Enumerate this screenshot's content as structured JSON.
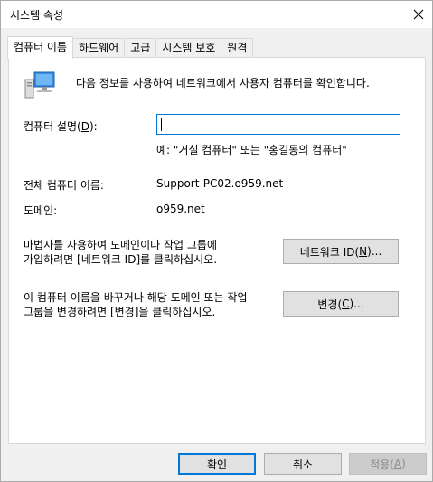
{
  "window": {
    "title": "시스템 속성",
    "close_icon": "close-icon"
  },
  "tabs": [
    {
      "label": "컴퓨터 이름",
      "active": true
    },
    {
      "label": "하드웨어",
      "active": false
    },
    {
      "label": "고급",
      "active": false
    },
    {
      "label": "시스템 보호",
      "active": false
    },
    {
      "label": "원격",
      "active": false
    }
  ],
  "computer_name_tab": {
    "icon": "computer-icon",
    "intro": "다음 정보를 사용하여 네트워크에서 사용자 컴퓨터를 확인합니다.",
    "description_label_pre": "컴퓨터 설명(",
    "description_label_key": "D",
    "description_label_post": "):",
    "description_value": "",
    "description_example": "예: \"거실 컴퓨터\" 또는 \"홍길동의 컴퓨터\"",
    "full_name_label": "전체 컴퓨터 이름:",
    "full_name_value": "Support-PC02.o959.net",
    "domain_label": "도메인:",
    "domain_value": "o959.net",
    "wizard_text_line1": "마법사를 사용하여 도메인이나 작업 그룹에",
    "wizard_text_line2": "가입하려면 [네트워크 ID]를 클릭하십시오.",
    "network_id_button_pre": "네트워크 ID(",
    "network_id_button_key": "N",
    "network_id_button_post": ")...",
    "change_text_line1": "이 컴퓨터 이름을 바꾸거나 해당 도메인 또는 작업",
    "change_text_line2": "그룹을 변경하려면 [변경]을 클릭하십시오.",
    "change_button_pre": "변경(",
    "change_button_key": "C",
    "change_button_post": ")..."
  },
  "footer": {
    "ok_label": "확인",
    "cancel_label": "취소",
    "apply_pre": "적용(",
    "apply_key": "A",
    "apply_post": ")"
  }
}
